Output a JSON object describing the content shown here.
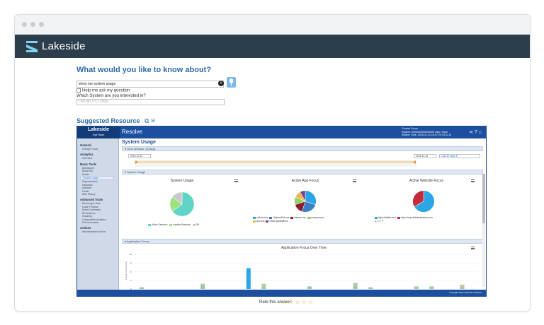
{
  "app": {
    "name": "Lakeside"
  },
  "query": {
    "title": "What would you like to know about?",
    "input_value": "show me system usage",
    "help_label": "Help me ask my question",
    "system_label": "Which System are you interested in?",
    "system_value": "LAP-4F07C7-DE01"
  },
  "suggested": {
    "title": "Suggested Resource"
  },
  "resource": {
    "logo_line1": "Lakeside",
    "logo_line2": "SysTrack",
    "title": "Resolve",
    "info_line1": "Current Focus",
    "info_line2": "System: 0000000000000000   User: None",
    "info_line3": "System Time: 2016-11-14 15:07:29 UTC(-5)",
    "page_title": "System Usage",
    "time_window": "Time Window: 30 days",
    "date_start": "2016-10-15",
    "date_end": "2016-11-14",
    "range_label": "Last 30 Days",
    "system_usage_header": "System Usage",
    "application_focus_header": "Application Focus",
    "footer": "Copyright 2016 Lakeside Software"
  },
  "sidebar": {
    "sections": [
      {
        "title": "General",
        "items": [
          "Change Focus"
        ]
      },
      {
        "title": "Analytics",
        "items": [
          "Overview"
        ]
      },
      {
        "title": "Basic Tools",
        "items": [
          "Dashboard",
          "Black Box",
          "Health",
          "System Usage",
          "Dependencies",
          "Hardware",
          "Software",
          "Faults",
          "Web History"
        ]
      },
      {
        "title": "Advanced Tools",
        "items": [
          "Boot/Logon Time",
          "Logon Process",
          "Event Correlation",
          "All Sessions",
          "Graphing",
          "Computation Analytics",
          "File Information"
        ]
      },
      {
        "title": "Actions",
        "items": [
          "Administrative Actions"
        ]
      }
    ],
    "active_item": "System Usage"
  },
  "panels": {
    "system_usage": {
      "title": "System Usage",
      "legend": [
        "Active Sessions",
        "Inactive Sessions",
        "Off"
      ]
    },
    "app_focus": {
      "title": "Active App Focus",
      "legend": [
        "outlook.exe",
        "vSphereEUI.exe",
        "chrome.exe",
        "powerpnt.exe",
        "lync.exe",
        "Other Applications"
      ]
    },
    "web_focus": {
      "title": "Active Website Focus",
      "legend": [
        "https://twitter.com",
        "http://help.clickdimensions.com"
      ]
    },
    "app_focus_over_time": {
      "title": "Application Focus Over Time"
    }
  },
  "chart_data": [
    {
      "type": "pie",
      "title": "System Usage",
      "labels": [
        "Active Sessions",
        "Inactive Sessions",
        "Off"
      ],
      "values": [
        65,
        20,
        15
      ],
      "colors": [
        "#5fd3c4",
        "#9be37e",
        "#c9c9c9"
      ]
    },
    {
      "type": "pie",
      "title": "Active App Focus",
      "labels": [
        "outlook.exe",
        "vSphereEUI.exe",
        "chrome.exe",
        "powerpnt.exe",
        "lync.exe",
        "Other Applications"
      ],
      "values": [
        30,
        25,
        15,
        12,
        10,
        8
      ],
      "colors": [
        "#2aa5e6",
        "#3a7ec6",
        "#8b1d2c",
        "#8fd36a",
        "#f2b44a",
        "#7b3f8f"
      ]
    },
    {
      "type": "pie",
      "title": "Active Website Focus",
      "labels": [
        "https://twitter.com",
        "http://help.clickdimensions.com"
      ],
      "values": [
        40,
        20
      ],
      "colors": [
        "#2aa5e6",
        "#c52a3a"
      ]
    },
    {
      "type": "bar",
      "title": "Application Focus Over Time",
      "ylim": [
        0,
        20
      ],
      "ylabel": "Focus Time (hours)",
      "values_bottom": [
        1,
        0,
        0,
        0,
        2,
        0,
        0,
        6,
        1,
        0,
        0,
        1.5,
        0,
        0,
        2,
        1,
        0,
        0,
        1,
        1,
        0,
        1
      ],
      "values_top": [
        0,
        0,
        0,
        0,
        1,
        0,
        0,
        6,
        2,
        0,
        0,
        0,
        0,
        0,
        1.5,
        0,
        0,
        0,
        0.5,
        0.5,
        0,
        1.5
      ]
    }
  ],
  "rating": {
    "label": "Rate this answer:",
    "stars": "☆☆☆☆☆"
  },
  "colors": {
    "topbar": "#2c3e4b",
    "accent": "#2d6aa6",
    "resource_header": "#1c4fa0"
  }
}
